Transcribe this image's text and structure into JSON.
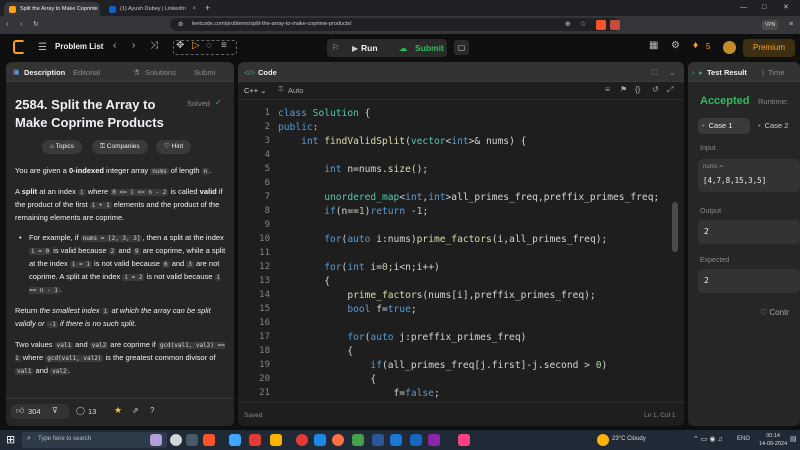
{
  "browser": {
    "tabs": [
      {
        "title": "Split the Array to Make Coprime",
        "active": true,
        "color": "#ffa116"
      },
      {
        "title": "(1) Ayush Dubey | LinkedIn",
        "active": false,
        "color": "#0a66c2"
      }
    ],
    "url": "leetcode.com/problems/split-the-array-to-make-coprime-products/",
    "vpn": "VPN"
  },
  "nav": {
    "problem_list": "Problem List",
    "run": "Run",
    "submit": "Submit",
    "streak": "5",
    "premium": "Premium"
  },
  "left": {
    "tabs": [
      "Description",
      "Editorial",
      "Solutions",
      "Submi"
    ],
    "title": "2584. Split the Array to Make Coprime Products",
    "solved": "Solved",
    "chips": [
      "Topics",
      "Companies",
      "Hint"
    ],
    "p1": [
      "You are given a ",
      "0-indexed",
      " integer array ",
      "nums",
      " of length ",
      "n",
      "."
    ],
    "p2": [
      "A ",
      "split",
      " at an index ",
      "i",
      " where ",
      "0 <= i <= n - 2",
      " is called ",
      "valid",
      " if the product of the first ",
      "i + 1",
      " elements and the product of the remaining elements are coprime."
    ],
    "p3": [
      "For example, if ",
      "nums = [2, 3, 3]",
      ", then a split at the index ",
      "i = 0",
      " is valid because ",
      "2",
      " and ",
      "9",
      " are coprime, while a split at the index ",
      "i = 1",
      " is not valid because ",
      "6",
      " and ",
      "3",
      " are not coprime. A split at the index ",
      "i = 2",
      " is not valid because ",
      "i == n - 1",
      "."
    ],
    "p4": [
      "Return ",
      "the smallest index ",
      "i",
      " at which the array can be split validly",
      " or ",
      "-1",
      " if there is no such split",
      "."
    ],
    "p5": [
      "Two values ",
      "val1",
      " and ",
      "val2",
      " are coprime if ",
      "gcd(val1, val2) == 1",
      " where ",
      "gcd(val1, val2)",
      " is the greatest common divisor of ",
      "val1",
      " and ",
      "val2",
      "."
    ],
    "likes": "304",
    "comments": "13"
  },
  "code": {
    "tab": "Code",
    "lang": "C++",
    "mode": "Auto",
    "saved": "Saved",
    "cursor": "Ln 1, Col 1",
    "lines": [
      {
        "n": "1",
        "t": "class Solution {"
      },
      {
        "n": "2",
        "t": "public:"
      },
      {
        "n": "3",
        "t": "    int findValidSplit(vector<int>& nums) {"
      },
      {
        "n": "4",
        "t": ""
      },
      {
        "n": "5",
        "t": "        int n=nums.size();"
      },
      {
        "n": "6",
        "t": ""
      },
      {
        "n": "7",
        "t": "        unordered_map<int,int>all_primes_freq,preffix_primes_freq;"
      },
      {
        "n": "8",
        "t": "        if(n==1)return -1;"
      },
      {
        "n": "9",
        "t": ""
      },
      {
        "n": "10",
        "t": "        for(auto i:nums)prime_factors(i,all_primes_freq);"
      },
      {
        "n": "11",
        "t": ""
      },
      {
        "n": "12",
        "t": "        for(int i=0;i<n;i++)"
      },
      {
        "n": "13",
        "t": "        {"
      },
      {
        "n": "14",
        "t": "            prime_factors(nums[i],preffix_primes_freq);"
      },
      {
        "n": "15",
        "t": "            bool f=true;"
      },
      {
        "n": "16",
        "t": ""
      },
      {
        "n": "17",
        "t": "            for(auto j:preffix_primes_freq)"
      },
      {
        "n": "18",
        "t": "            {"
      },
      {
        "n": "19",
        "t": "                if(all_primes_freq[j.first]-j.second > 0)"
      },
      {
        "n": "20",
        "t": "                {"
      },
      {
        "n": "21",
        "t": "                    f=false;"
      }
    ]
  },
  "result": {
    "tab": "Test Result",
    "tab2": "Time",
    "status": "Accepted",
    "runtime": "Runtime:",
    "cases": [
      "Case 1",
      "Case 2"
    ],
    "input_label": "Input",
    "input_var": "nums =",
    "input_val": "[4,7,8,15,3,5]",
    "output_label": "Output",
    "output_val": "2",
    "expected_label": "Expected",
    "expected_val": "2",
    "contribute": "Contr"
  },
  "taskbar": {
    "search": "Type here to search",
    "weather": "23°C  Cloudy",
    "lang": "ENG",
    "time": "00:14",
    "date": "14-09-2024"
  },
  "colors": {
    "accent": "#ffa116",
    "green": "#2cbb5d",
    "bg": "#0f0f0f",
    "panel": "#262626"
  }
}
